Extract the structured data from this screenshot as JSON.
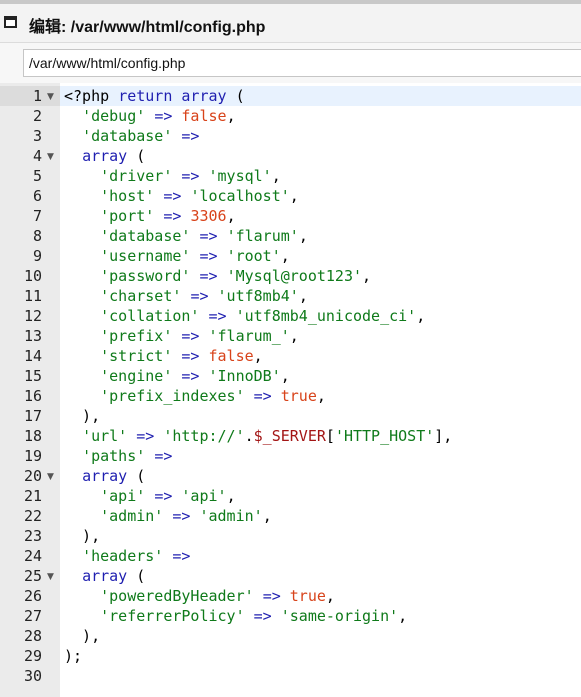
{
  "window": {
    "title": "编辑: /var/www/html/config.php",
    "path_value": "/var/www/html/config.php"
  },
  "colors": {
    "keyword": "#1f1fb0",
    "string": "#0f7a1a",
    "number": "#d8431a",
    "boolean": "#d8431a",
    "active_line": "#e8f2fe",
    "gutter": "#ebebeb"
  },
  "editor": {
    "active_line": 1,
    "lines": [
      {
        "num": "1",
        "fold": true,
        "tokens": [
          [
            "plain",
            "<?php "
          ],
          [
            "kw",
            "return"
          ],
          [
            "plain",
            " "
          ],
          [
            "kw",
            "array"
          ],
          [
            "plain",
            " ("
          ]
        ]
      },
      {
        "num": "2",
        "tokens": [
          [
            "plain",
            "  "
          ],
          [
            "str",
            "'debug'"
          ],
          [
            "plain",
            " "
          ],
          [
            "kw",
            "=>"
          ],
          [
            "plain",
            " "
          ],
          [
            "bool",
            "false"
          ],
          [
            "plain",
            ","
          ]
        ]
      },
      {
        "num": "3",
        "tokens": [
          [
            "plain",
            "  "
          ],
          [
            "str",
            "'database'"
          ],
          [
            "plain",
            " "
          ],
          [
            "kw",
            "=>"
          ]
        ]
      },
      {
        "num": "4",
        "fold": true,
        "tokens": [
          [
            "plain",
            "  "
          ],
          [
            "kw",
            "array"
          ],
          [
            "plain",
            " ("
          ]
        ]
      },
      {
        "num": "5",
        "tokens": [
          [
            "plain",
            "    "
          ],
          [
            "str",
            "'driver'"
          ],
          [
            "plain",
            " "
          ],
          [
            "kw",
            "=>"
          ],
          [
            "plain",
            " "
          ],
          [
            "str",
            "'mysql'"
          ],
          [
            "plain",
            ","
          ]
        ]
      },
      {
        "num": "6",
        "tokens": [
          [
            "plain",
            "    "
          ],
          [
            "str",
            "'host'"
          ],
          [
            "plain",
            " "
          ],
          [
            "kw",
            "=>"
          ],
          [
            "plain",
            " "
          ],
          [
            "str",
            "'localhost'"
          ],
          [
            "plain",
            ","
          ]
        ]
      },
      {
        "num": "7",
        "tokens": [
          [
            "plain",
            "    "
          ],
          [
            "str",
            "'port'"
          ],
          [
            "plain",
            " "
          ],
          [
            "kw",
            "=>"
          ],
          [
            "plain",
            " "
          ],
          [
            "num",
            "3306"
          ],
          [
            "plain",
            ","
          ]
        ]
      },
      {
        "num": "8",
        "tokens": [
          [
            "plain",
            "    "
          ],
          [
            "str",
            "'database'"
          ],
          [
            "plain",
            " "
          ],
          [
            "kw",
            "=>"
          ],
          [
            "plain",
            " "
          ],
          [
            "str",
            "'flarum'"
          ],
          [
            "plain",
            ","
          ]
        ]
      },
      {
        "num": "9",
        "tokens": [
          [
            "plain",
            "    "
          ],
          [
            "str",
            "'username'"
          ],
          [
            "plain",
            " "
          ],
          [
            "kw",
            "=>"
          ],
          [
            "plain",
            " "
          ],
          [
            "str",
            "'root'"
          ],
          [
            "plain",
            ","
          ]
        ]
      },
      {
        "num": "10",
        "tokens": [
          [
            "plain",
            "    "
          ],
          [
            "str",
            "'password'"
          ],
          [
            "plain",
            " "
          ],
          [
            "kw",
            "=>"
          ],
          [
            "plain",
            " "
          ],
          [
            "str",
            "'Mysql@root123'"
          ],
          [
            "plain",
            ","
          ]
        ]
      },
      {
        "num": "11",
        "tokens": [
          [
            "plain",
            "    "
          ],
          [
            "str",
            "'charset'"
          ],
          [
            "plain",
            " "
          ],
          [
            "kw",
            "=>"
          ],
          [
            "plain",
            " "
          ],
          [
            "str",
            "'utf8mb4'"
          ],
          [
            "plain",
            ","
          ]
        ]
      },
      {
        "num": "12",
        "tokens": [
          [
            "plain",
            "    "
          ],
          [
            "str",
            "'collation'"
          ],
          [
            "plain",
            " "
          ],
          [
            "kw",
            "=>"
          ],
          [
            "plain",
            " "
          ],
          [
            "str",
            "'utf8mb4_unicode_ci'"
          ],
          [
            "plain",
            ","
          ]
        ]
      },
      {
        "num": "13",
        "tokens": [
          [
            "plain",
            "    "
          ],
          [
            "str",
            "'prefix'"
          ],
          [
            "plain",
            " "
          ],
          [
            "kw",
            "=>"
          ],
          [
            "plain",
            " "
          ],
          [
            "str",
            "'flarum_'"
          ],
          [
            "plain",
            ","
          ]
        ]
      },
      {
        "num": "14",
        "tokens": [
          [
            "plain",
            "    "
          ],
          [
            "str",
            "'strict'"
          ],
          [
            "plain",
            " "
          ],
          [
            "kw",
            "=>"
          ],
          [
            "plain",
            " "
          ],
          [
            "bool",
            "false"
          ],
          [
            "plain",
            ","
          ]
        ]
      },
      {
        "num": "15",
        "tokens": [
          [
            "plain",
            "    "
          ],
          [
            "str",
            "'engine'"
          ],
          [
            "plain",
            " "
          ],
          [
            "kw",
            "=>"
          ],
          [
            "plain",
            " "
          ],
          [
            "str",
            "'InnoDB'"
          ],
          [
            "plain",
            ","
          ]
        ]
      },
      {
        "num": "16",
        "tokens": [
          [
            "plain",
            "    "
          ],
          [
            "str",
            "'prefix_indexes'"
          ],
          [
            "plain",
            " "
          ],
          [
            "kw",
            "=>"
          ],
          [
            "plain",
            " "
          ],
          [
            "bool",
            "true"
          ],
          [
            "plain",
            ","
          ]
        ]
      },
      {
        "num": "17",
        "tokens": [
          [
            "plain",
            "  ),"
          ]
        ]
      },
      {
        "num": "18",
        "tokens": [
          [
            "plain",
            "  "
          ],
          [
            "str",
            "'url'"
          ],
          [
            "plain",
            " "
          ],
          [
            "kw",
            "=>"
          ],
          [
            "plain",
            " "
          ],
          [
            "str",
            "'http://'"
          ],
          [
            "plain",
            "."
          ],
          [
            "var",
            "$_SERVER"
          ],
          [
            "plain",
            "["
          ],
          [
            "str",
            "'HTTP_HOST'"
          ],
          [
            "plain",
            "],"
          ]
        ]
      },
      {
        "num": "19",
        "tokens": [
          [
            "plain",
            "  "
          ],
          [
            "str",
            "'paths'"
          ],
          [
            "plain",
            " "
          ],
          [
            "kw",
            "=>"
          ]
        ]
      },
      {
        "num": "20",
        "fold": true,
        "tokens": [
          [
            "plain",
            "  "
          ],
          [
            "kw",
            "array"
          ],
          [
            "plain",
            " ("
          ]
        ]
      },
      {
        "num": "21",
        "tokens": [
          [
            "plain",
            "    "
          ],
          [
            "str",
            "'api'"
          ],
          [
            "plain",
            " "
          ],
          [
            "kw",
            "=>"
          ],
          [
            "plain",
            " "
          ],
          [
            "str",
            "'api'"
          ],
          [
            "plain",
            ","
          ]
        ]
      },
      {
        "num": "22",
        "tokens": [
          [
            "plain",
            "    "
          ],
          [
            "str",
            "'admin'"
          ],
          [
            "plain",
            " "
          ],
          [
            "kw",
            "=>"
          ],
          [
            "plain",
            " "
          ],
          [
            "str",
            "'admin'"
          ],
          [
            "plain",
            ","
          ]
        ]
      },
      {
        "num": "23",
        "tokens": [
          [
            "plain",
            "  ),"
          ]
        ]
      },
      {
        "num": "24",
        "tokens": [
          [
            "plain",
            "  "
          ],
          [
            "str",
            "'headers'"
          ],
          [
            "plain",
            " "
          ],
          [
            "kw",
            "=>"
          ]
        ]
      },
      {
        "num": "25",
        "fold": true,
        "tokens": [
          [
            "plain",
            "  "
          ],
          [
            "kw",
            "array"
          ],
          [
            "plain",
            " ("
          ]
        ]
      },
      {
        "num": "26",
        "tokens": [
          [
            "plain",
            "    "
          ],
          [
            "str",
            "'poweredByHeader'"
          ],
          [
            "plain",
            " "
          ],
          [
            "kw",
            "=>"
          ],
          [
            "plain",
            " "
          ],
          [
            "bool",
            "true"
          ],
          [
            "plain",
            ","
          ]
        ]
      },
      {
        "num": "27",
        "tokens": [
          [
            "plain",
            "    "
          ],
          [
            "str",
            "'referrerPolicy'"
          ],
          [
            "plain",
            " "
          ],
          [
            "kw",
            "=>"
          ],
          [
            "plain",
            " "
          ],
          [
            "str",
            "'same-origin'"
          ],
          [
            "plain",
            ","
          ]
        ]
      },
      {
        "num": "28",
        "tokens": [
          [
            "plain",
            "  ),"
          ]
        ]
      },
      {
        "num": "29",
        "tokens": [
          [
            "plain",
            ");"
          ]
        ]
      },
      {
        "num": "30",
        "tokens": []
      }
    ]
  }
}
